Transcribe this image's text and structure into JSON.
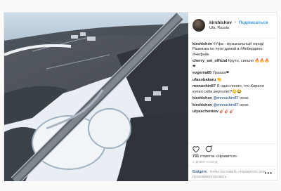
{
  "post": {
    "username": "kirshishov",
    "separator": "•",
    "follow_label": "Подписаться",
    "location": "Ufa, Russia",
    "comments": [
      {
        "author": "kirshishov",
        "text": "#Уфа - музыкальный город! Развязка по пути домой в #Акбердино. #Нефейк"
      },
      {
        "author": "cherry_set_official",
        "text": "Круто, сильно 🔥🔥🔥❤"
      },
      {
        "author": "evgenia85",
        "text": "Ураааа❤"
      },
      {
        "author": "ufasobakaru",
        "text": "👏"
      },
      {
        "author": "monuchin87",
        "text": "Я один понял, что Кирилл купил себе вертолет?😳😂"
      },
      {
        "author": "kirshishov",
        "mention": "@monuchin87",
        "text": "нене."
      },
      {
        "author": "kirshishov",
        "mention": "@monuchin87",
        "text": "нене."
      },
      {
        "author": "ulyaschenkov",
        "text": "🎸🎸🎸"
      }
    ],
    "likes_count": "731",
    "likes_word": "отметок «Нравится»",
    "time": "1 дней назад",
    "login_link": "Войдите",
    "login_text": ", чтобы поставить «Нравится» или прокомментировать.",
    "more_label": "•••"
  },
  "icons": {
    "like": "heart-icon",
    "comment": "comment-icon",
    "avatar": "profile-photo"
  },
  "colors": {
    "link": "#3897f0",
    "mention": "#003569",
    "meta": "#999999"
  }
}
